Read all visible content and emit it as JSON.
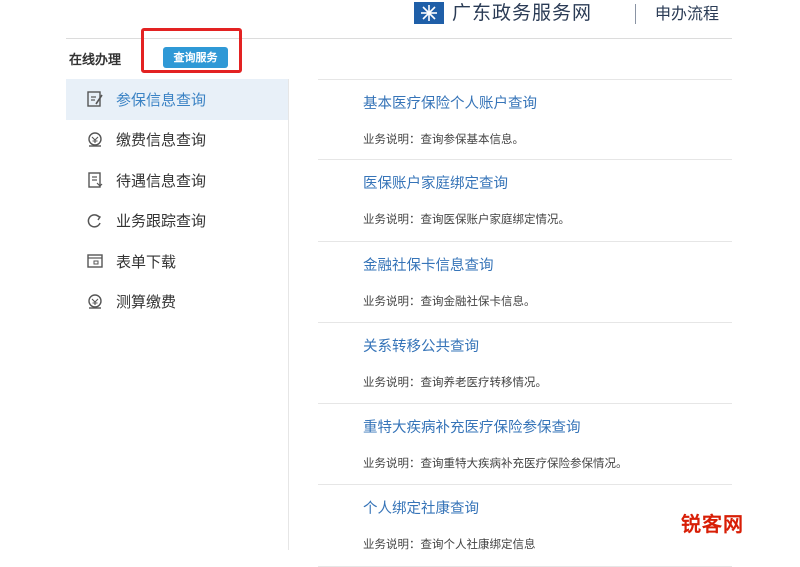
{
  "header": {
    "site_title": "广东政务服务网",
    "nav_link": "申办流程"
  },
  "online_label": "在线办理",
  "query_badge": "查询服务",
  "sidebar": {
    "items": [
      {
        "label": "参保信息查询",
        "icon": "form-edit-icon",
        "active": true
      },
      {
        "label": "缴费信息查询",
        "icon": "payment-icon",
        "active": false
      },
      {
        "label": "待遇信息查询",
        "icon": "document-icon",
        "active": false
      },
      {
        "label": "业务跟踪查询",
        "icon": "refresh-icon",
        "active": false
      },
      {
        "label": "表单下载",
        "icon": "calendar-form-icon",
        "active": false
      },
      {
        "label": "测算缴费",
        "icon": "calculator-icon",
        "active": false
      }
    ]
  },
  "services": [
    {
      "title": "基本医疗保险个人账户查询",
      "desc": "业务说明：查询参保基本信息。"
    },
    {
      "title": "医保账户家庭绑定查询",
      "desc": "业务说明：查询医保账户家庭绑定情况。"
    },
    {
      "title": "金融社保卡信息查询",
      "desc": "业务说明：查询金融社保卡信息。"
    },
    {
      "title": "关系转移公共查询",
      "desc": "业务说明：查询养老医疗转移情况。"
    },
    {
      "title": "重特大疾病补充医疗保险参保查询",
      "desc": "业务说明：查询重特大疾病补充医疗保险参保情况。"
    },
    {
      "title": "个人绑定社康查询",
      "desc": "业务说明：查询个人社康绑定信息"
    }
  ],
  "watermark": "锐客网",
  "colors": {
    "accent": "#3674b8",
    "badge": "#2f99d6",
    "highlight": "#e32222",
    "active_bg": "#e8f0f8"
  }
}
